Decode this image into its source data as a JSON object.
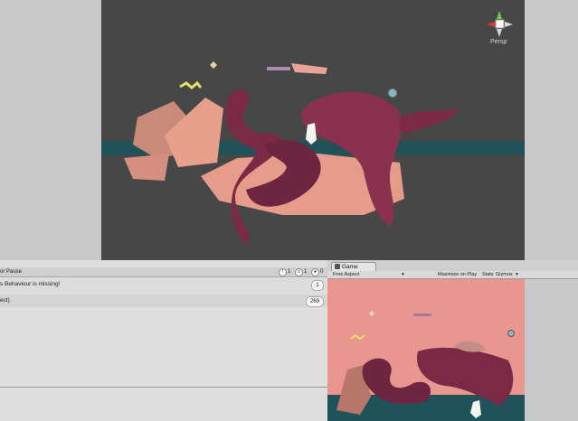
{
  "scene": {
    "camera_label": "Persp",
    "gizmo_icon": "axis-gizmo-icon"
  },
  "console": {
    "toolbar": {
      "pause_label": "or Pause",
      "counts": {
        "info": "1",
        "warning": "1",
        "error": "0"
      }
    },
    "logs": [
      {
        "message": "s Behaviour is missing!",
        "count": "1"
      },
      {
        "message": "ect)",
        "count": "269"
      }
    ]
  },
  "game": {
    "tab_label": "Game",
    "tab_icon": "game-controller-icon",
    "aspect_label": "Free Aspect",
    "aspect_arrow": "▾",
    "maximize_label": "Maximize on Play",
    "stats_label": "Stats",
    "gizmos_label": "Gizmos",
    "gizmos_arrow": "▾"
  },
  "colors": {
    "scene_bg": "#474747",
    "pink_terrain": "#e7a08d",
    "maroon_shape": "#7a2a44",
    "water": "#1f5259",
    "game_bg": "#e8968f"
  }
}
